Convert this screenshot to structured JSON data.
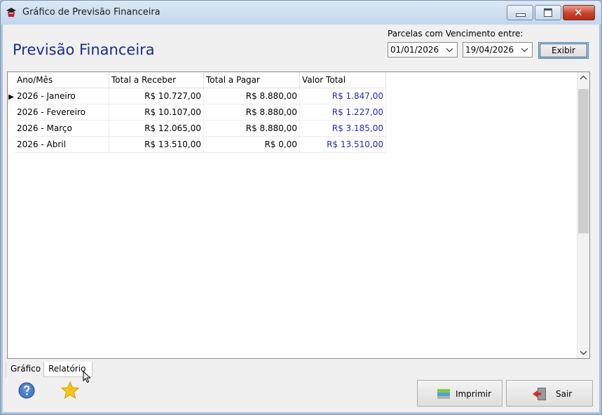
{
  "window": {
    "title": "Gráfico de Previsão Financeira",
    "controls": {
      "close_glyph": "✕"
    }
  },
  "header": {
    "heading": "Previsão Financeira",
    "range_label": "Parcelas com Vencimento entre:",
    "date_from": "01/01/2026",
    "date_to": "19/04/2026",
    "show_button": "Exibir"
  },
  "grid": {
    "columns": [
      "Ano/Mês",
      "Total a Receber",
      "Total a Pagar",
      "Valor Total"
    ],
    "rows": [
      {
        "ano_mes": "2026 - Janeiro",
        "receber": "R$ 10.727,00",
        "pagar": "R$ 8.880,00",
        "total": "R$ 1.847,00"
      },
      {
        "ano_mes": "2026 - Fevereiro",
        "receber": "R$ 10.107,00",
        "pagar": "R$ 8.880,00",
        "total": "R$ 1.227,00"
      },
      {
        "ano_mes": "2026 - Março",
        "receber": "R$ 12.065,00",
        "pagar": "R$ 8.880,00",
        "total": "R$ 3.185,00"
      },
      {
        "ano_mes": "2026 - Abril",
        "receber": "R$ 13.510,00",
        "pagar": "R$ 0,00",
        "total": "R$ 13.510,00"
      }
    ],
    "selected_row": 0,
    "total_color": "#2727c7"
  },
  "tabs": [
    {
      "label": "Gráfico",
      "active": false
    },
    {
      "label": "Relatório",
      "active": true
    }
  ],
  "footer": {
    "print_label": "Imprimir",
    "exit_label": "Sair",
    "help_icon": "help-icon",
    "favorite_icon": "star-icon"
  },
  "colors": {
    "heading": "#1d2b8f",
    "titlebar": "#c3d6ec"
  }
}
